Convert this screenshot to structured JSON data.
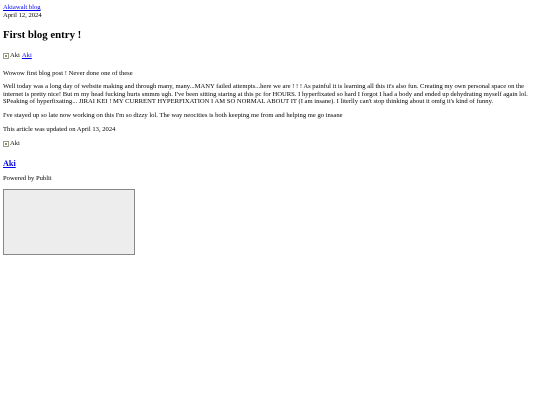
{
  "site": {
    "name": "Akiawalt blog"
  },
  "post": {
    "date": "April 12, 2024",
    "title": "First blog entry !",
    "author_alt": "Aki",
    "author_link": "Aki",
    "paragraphs": [
      "Wowow first blog post ! Never done one of these",
      "Well today was a long day of website making and through many, many...MANY failed attempts...here we are ! ! ! As painful it is learning all this it's also fun. Creating my own personal space on the internet is pretty nice! But rn my head fucking hurts smmm ugh. I've been sitting staring at this pc for HOURS. I hyperfixated so hard I forgot I had a body and ended up dehydrating myself again lol. SPeaking of hyperfixating... JIRAI KEI ! MY CURRENT HYPERFIXATION I AM SO NORMAL ABOUT IT (I am insane). I literlly can't stop thinking about it omfg it's kind of funny.",
      "I've stayed up so late now working on this I'm so dizzy lol. The way neocities is both keeping me from and helping me go insane"
    ],
    "updated": "This article was updated on April 13, 2024"
  },
  "author_box": {
    "image_alt": "Aki",
    "name": "Aki"
  },
  "footer": {
    "powered_by": "Powered by Publii"
  },
  "colors": {
    "link": "#0000ee",
    "text": "#000000",
    "embed_background": "#ededed",
    "embed_border": "#888888"
  },
  "icons": {
    "broken_image": "broken-image-icon"
  }
}
